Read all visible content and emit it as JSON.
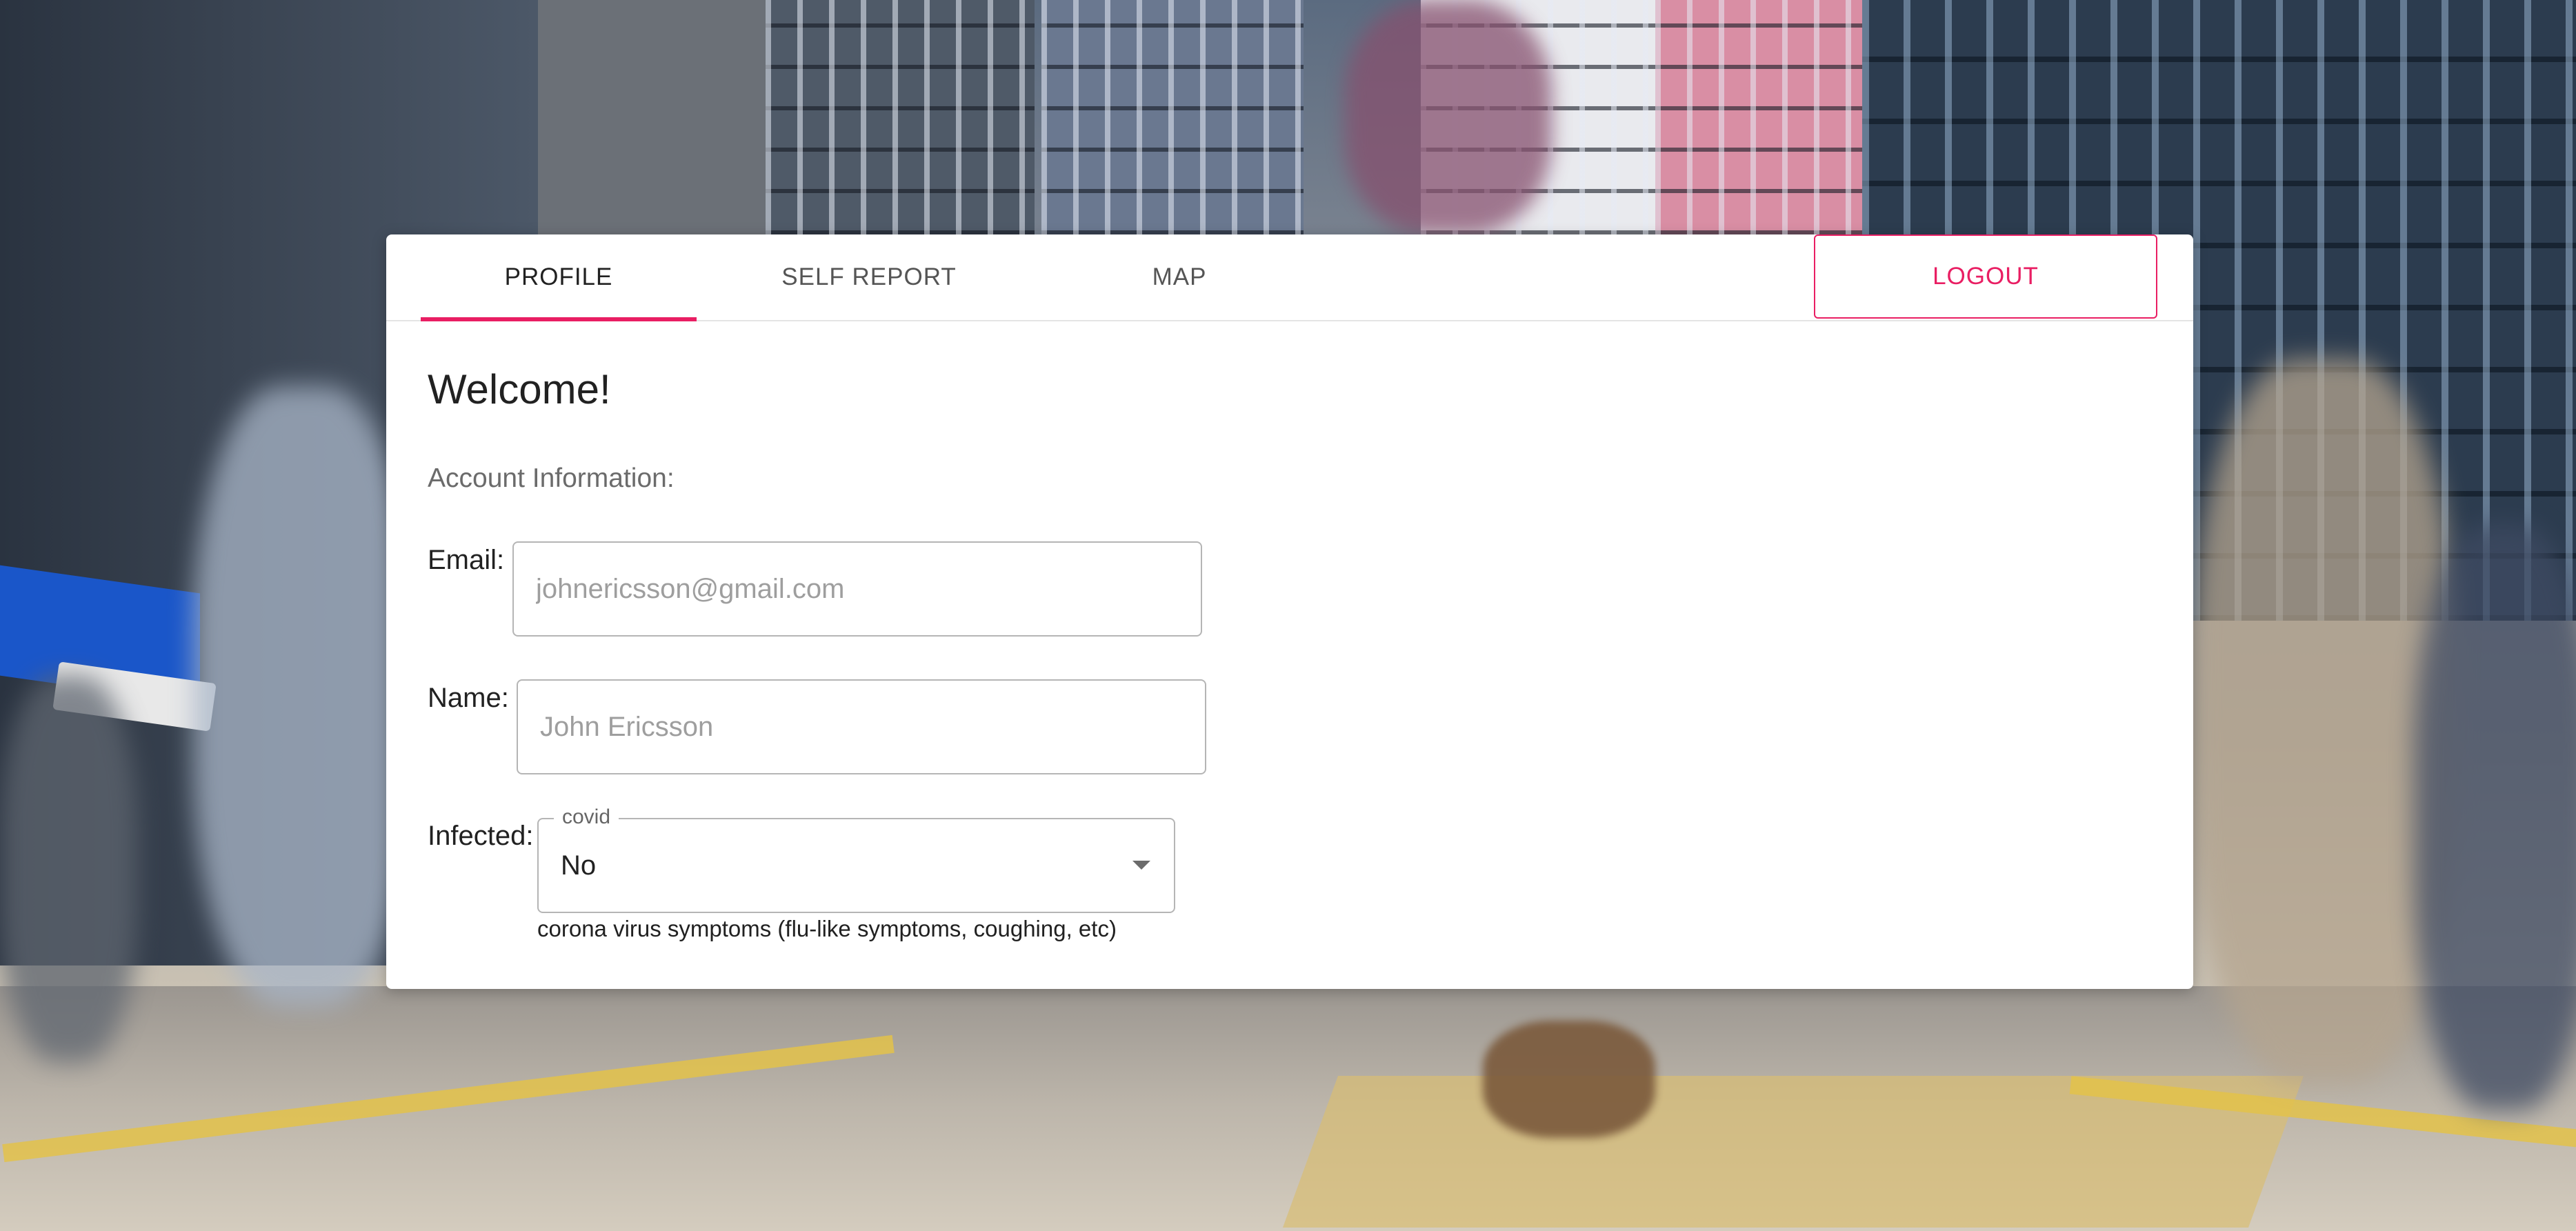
{
  "tabs": {
    "profile": "PROFILE",
    "self_report": "SELF REPORT",
    "map": "MAP",
    "active": "profile"
  },
  "logout_label": "LOGOUT",
  "profile": {
    "welcome": "Welcome!",
    "section_title": "Account Information:",
    "email": {
      "label": "Email:",
      "placeholder": "johnericsson@gmail.com",
      "value": ""
    },
    "name": {
      "label": "Name:",
      "placeholder": "John Ericsson",
      "value": ""
    },
    "infected": {
      "label": "Infected:",
      "select_legend": "covid",
      "selected": "No",
      "helper": "corona virus symptoms (flu-like symptoms, coughing, etc)"
    }
  },
  "colors": {
    "accent": "#e91e63",
    "card_bg": "#ffffff"
  },
  "icons": {
    "dropdown": "chevron-down-icon"
  }
}
